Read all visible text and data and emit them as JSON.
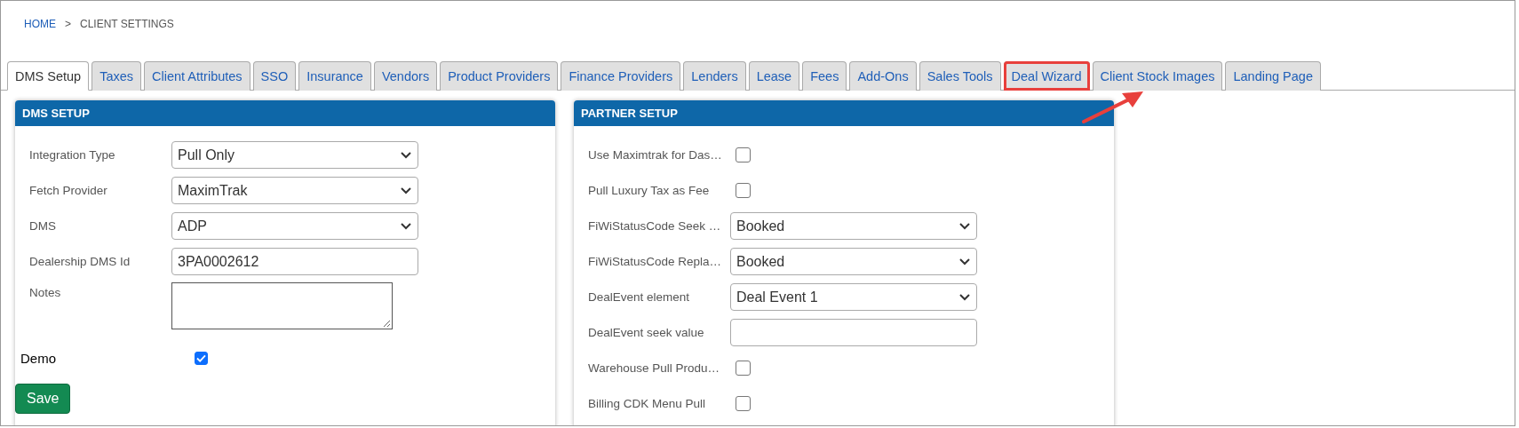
{
  "breadcrumb": [
    {
      "label": "HOME",
      "link": true
    },
    {
      "label": "CLIENT SETTINGS",
      "link": false
    }
  ],
  "breadcrumb_separator": ">",
  "tabs": [
    {
      "label": "DMS Setup",
      "selected": true,
      "highlighted": false
    },
    {
      "label": "Taxes",
      "selected": false,
      "highlighted": false
    },
    {
      "label": "Client Attributes",
      "selected": false,
      "highlighted": false
    },
    {
      "label": "SSO",
      "selected": false,
      "highlighted": false
    },
    {
      "label": "Insurance",
      "selected": false,
      "highlighted": false
    },
    {
      "label": "Vendors",
      "selected": false,
      "highlighted": false
    },
    {
      "label": "Product Providers",
      "selected": false,
      "highlighted": false
    },
    {
      "label": "Finance Providers",
      "selected": false,
      "highlighted": false
    },
    {
      "label": "Lenders",
      "selected": false,
      "highlighted": false
    },
    {
      "label": "Lease",
      "selected": false,
      "highlighted": false
    },
    {
      "label": "Fees",
      "selected": false,
      "highlighted": false
    },
    {
      "label": "Add-Ons",
      "selected": false,
      "highlighted": false
    },
    {
      "label": "Sales Tools",
      "selected": false,
      "highlighted": false
    },
    {
      "label": "Deal Wizard",
      "selected": false,
      "highlighted": true
    },
    {
      "label": "Client Stock Images",
      "selected": false,
      "highlighted": false
    },
    {
      "label": "Landing Page",
      "selected": false,
      "highlighted": false
    }
  ],
  "panels": [
    {
      "title": "DMS SETUP",
      "fields": [
        {
          "kind": "select",
          "label": "Integration Type",
          "value": "Pull Only"
        },
        {
          "kind": "select",
          "label": "Fetch Provider",
          "value": "MaximTrak"
        },
        {
          "kind": "select",
          "label": "DMS",
          "value": "ADP"
        },
        {
          "kind": "text",
          "label": "Dealership DMS Id",
          "value": "3PA0002612"
        },
        {
          "kind": "textarea",
          "label": "Notes"
        }
      ],
      "demo": {
        "label": "Demo",
        "checked": true
      },
      "button": "Save"
    },
    {
      "title": "PARTNER SETUP",
      "fields": [
        {
          "kind": "checkbox",
          "label": "Use Maximtrak for Das…",
          "checked": false
        },
        {
          "kind": "checkbox",
          "label": "Pull Luxury Tax as Fee",
          "checked": false
        },
        {
          "kind": "select",
          "label": "FiWiStatusCode Seek …",
          "value": "Booked"
        },
        {
          "kind": "select",
          "label": "FiWiStatusCode Repla…",
          "value": "Booked"
        },
        {
          "kind": "select",
          "label": "DealEvent element",
          "value": "Deal Event 1"
        },
        {
          "kind": "text",
          "label": "DealEvent seek value"
        },
        {
          "kind": "checkbox",
          "label": "Warehouse Pull Produ…",
          "checked": false
        },
        {
          "kind": "checkbox",
          "label": "Billing CDK Menu Pull",
          "checked": false
        }
      ]
    }
  ]
}
